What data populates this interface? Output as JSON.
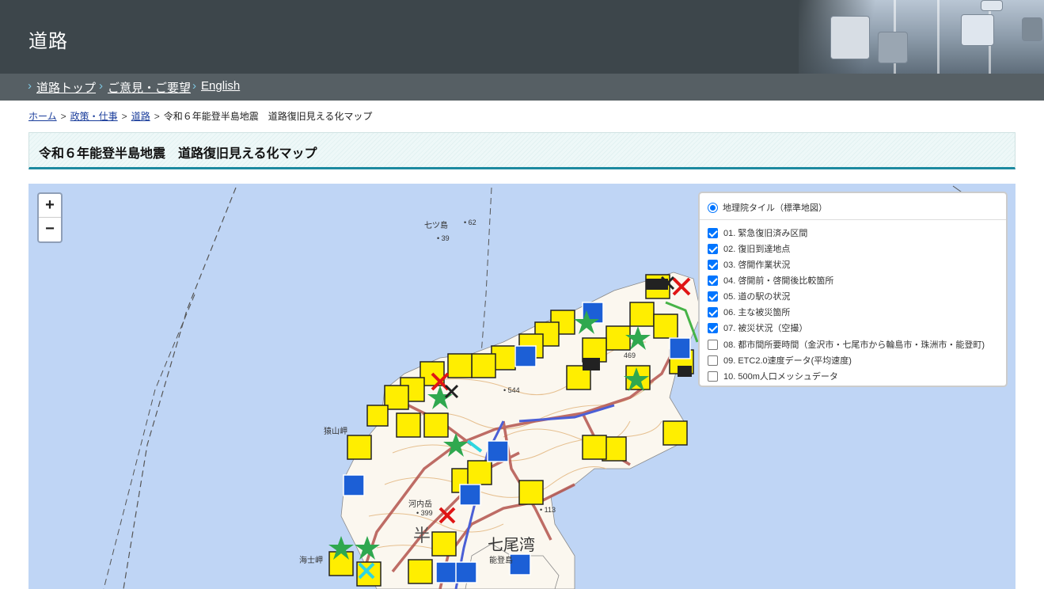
{
  "header": {
    "title": "道路"
  },
  "nav": {
    "items": [
      {
        "label": "道路トップ"
      },
      {
        "label": "ご意見・ご要望"
      },
      {
        "label": "English"
      }
    ]
  },
  "breadcrumb": {
    "items": [
      {
        "label": "ホーム",
        "link": true
      },
      {
        "label": "政策・仕事",
        "link": true
      },
      {
        "label": "道路",
        "link": true
      },
      {
        "label": "令和６年能登半島地震　道路復旧見える化マップ",
        "link": false
      }
    ],
    "separator": ">"
  },
  "page": {
    "title": "令和６年能登半島地震　道路復旧見える化マップ"
  },
  "map": {
    "zoom_in": "+",
    "zoom_out": "−",
    "base_layer": {
      "label": "地理院タイル（標準地図）",
      "selected": true
    },
    "overlays": [
      {
        "label": "01. 緊急復旧済み区間",
        "checked": true
      },
      {
        "label": "02. 復旧到達地点",
        "checked": true
      },
      {
        "label": "03. 啓開作業状況",
        "checked": true
      },
      {
        "label": "04. 啓開前・啓開後比較箇所",
        "checked": true
      },
      {
        "label": "05. 道の駅の状況",
        "checked": true
      },
      {
        "label": "06. 主な被災箇所",
        "checked": true
      },
      {
        "label": "07. 被災状況（空撮）",
        "checked": true
      },
      {
        "label": "08. 都市間所要時間（金沢市・七尾市から輪島市・珠洲市・能登町)",
        "checked": false
      },
      {
        "label": "09. ETC2.0速度データ(平均速度)",
        "checked": false
      },
      {
        "label": "10. 500m人口メッシュデータ",
        "checked": false
      }
    ],
    "labels": {
      "nanatsujima": "七ツ島",
      "elev62": "62",
      "elev39": "39",
      "elev544": "544",
      "elev469": "469",
      "sarumayamamisaki": "猿山岬",
      "kochidake": "河内岳",
      "elev399": "399",
      "elev113": "113",
      "nanaowan": "七尾湾",
      "amamisaki": "海士岬",
      "notojima": "能登島",
      "hanto": "半"
    },
    "colors": {
      "sea": "#bfd5f5",
      "land": "#fbf7ef",
      "road": "#b4544e",
      "contour": "#e6bf8f",
      "marker_yellow": "#ffee00",
      "marker_blue": "#1c5fd6"
    }
  }
}
